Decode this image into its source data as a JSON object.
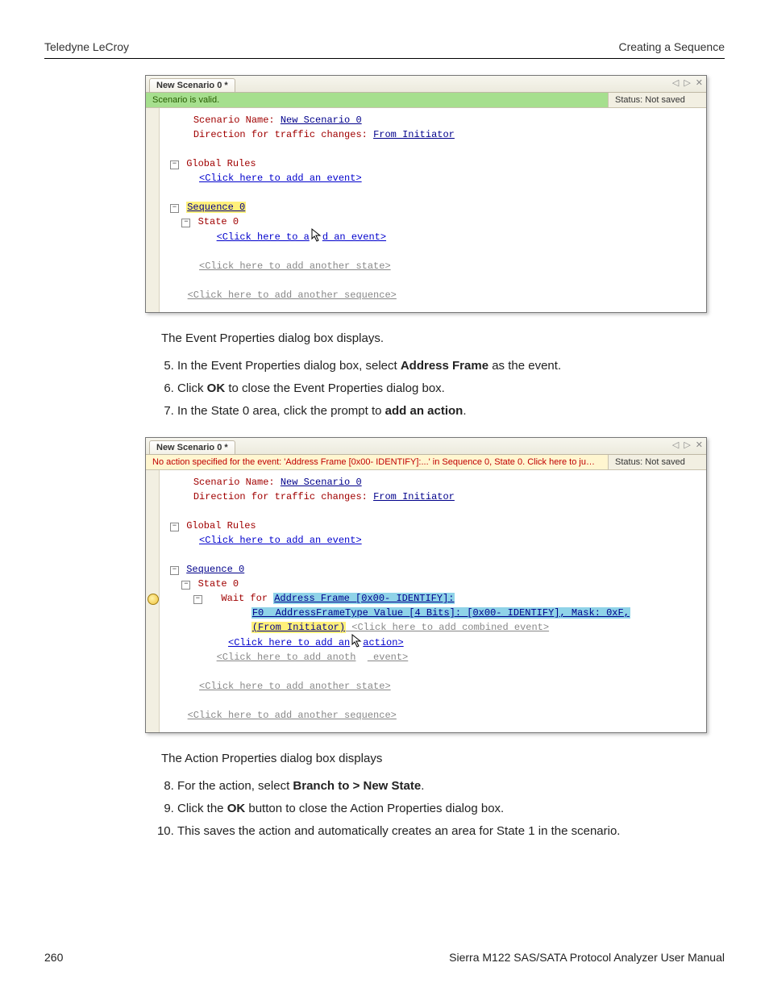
{
  "header": {
    "left": "Teledyne LeCroy",
    "right": "Creating a Sequence"
  },
  "footer": {
    "page": "260",
    "manual": "Sierra M122 SAS/SATA Protocol Analyzer User Manual"
  },
  "para1": "The Event Properties dialog box displays.",
  "steps1": [
    {
      "pre": "In the Event Properties dialog box, select ",
      "bold": "Address Frame",
      "post": " as the event."
    },
    {
      "pre": "Click ",
      "bold": "OK",
      "post": " to close the Event Properties dialog box."
    },
    {
      "pre": "In the State 0 area, click the prompt to ",
      "bold": "add an action",
      "post": "."
    }
  ],
  "para2": "The Action Properties dialog box displays",
  "steps2": [
    {
      "pre": "For the action, select ",
      "bold": "Branch to > New State",
      "post": "."
    },
    {
      "pre": "Click the ",
      "bold": "OK",
      "post": " button to close the Action Properties dialog box."
    },
    {
      "pre": "This saves the action and automatically creates an area for State 1 in the scenario.",
      "bold": "",
      "post": ""
    }
  ],
  "shot1": {
    "tab": "New Scenario 0 *",
    "status_msg": "Scenario is valid.",
    "status_save": "Status: Not saved",
    "lbl_scenario_name": "Scenario Name: ",
    "val_scenario_name": "New Scenario 0",
    "lbl_direction": "Direction for traffic changes: ",
    "val_direction": "From Initiator",
    "global_rules": "Global Rules",
    "add_event": "<Click here to add an event>",
    "sequence0": "Sequence 0",
    "state0": "State 0",
    "add_event_split_a": "<Click here to a",
    "add_event_split_b": "d an event>",
    "add_state": "<Click here to add another state>",
    "add_sequence": "<Click here to add another sequence>"
  },
  "shot2": {
    "tab": "New Scenario 0 *",
    "status_msg": "No action specified for the event: 'Address Frame [0x00- IDENTIFY]:...' in Sequence 0, State 0.  Click here to jump to the pro...",
    "status_save": "Status: Not saved",
    "lbl_scenario_name": "Scenario Name: ",
    "val_scenario_name": "New Scenario 0",
    "lbl_direction": "Direction for traffic changes: ",
    "val_direction": "From Initiator",
    "global_rules": "Global Rules",
    "add_event": "<Click here to add an event>",
    "sequence0": "Sequence 0",
    "state0": "State 0",
    "wait_for": "Wait for ",
    "addr_frame": "Address Frame [0x00- IDENTIFY]:",
    "f0_line": "F0  AddressFrameType Value [4 Bits]: [0x00- IDENTIFY], Mask: 0xF,",
    "from_init": "(From Initiator)",
    "add_combined": " <Click here to add combined event>",
    "add_action_a": "<Click here to add an",
    "add_action_b": "action>",
    "add_another_event": "<Click here to add anoth",
    "add_another_event_b": " event>",
    "add_state": "<Click here to add another state>",
    "add_sequence": "<Click here to add another sequence>"
  }
}
